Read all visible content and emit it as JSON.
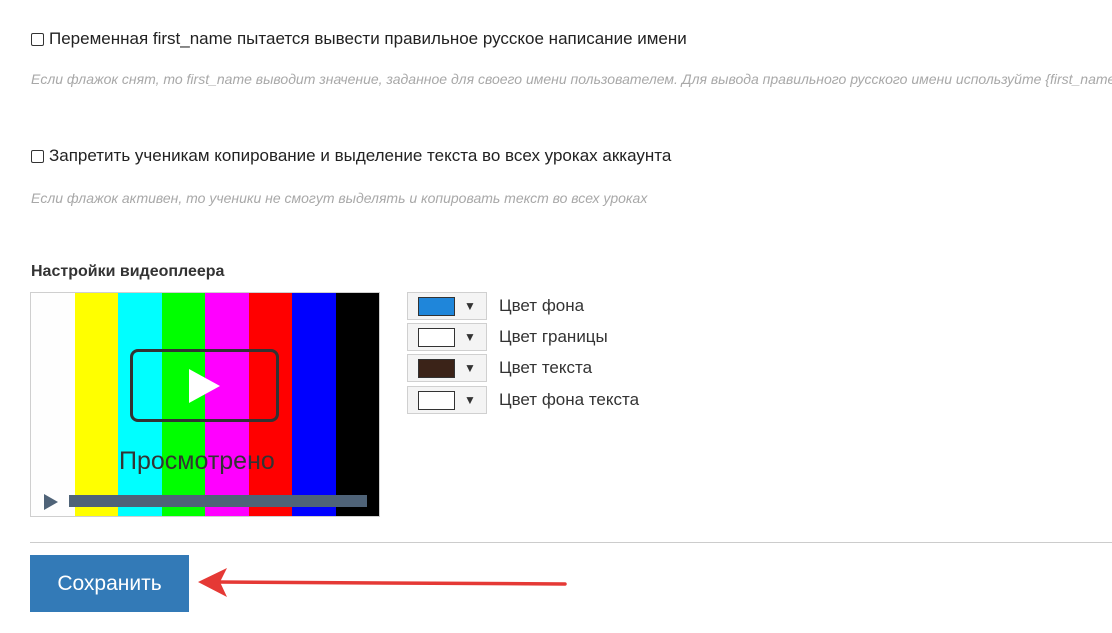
{
  "options": [
    {
      "label": "Переменная first_name пытается вывести правильное русское написание имени",
      "hint": "Если флажок снят, то first_name выводит значение, заданное для своего имени пользователем. Для вывода правильного русского имени используйте {first_name}",
      "checked": false
    },
    {
      "label": "Запретить ученикам копирование и выделение текста во всех уроках аккаунта",
      "hint": "Если флажок активен, то ученики не смогут выделять и копировать текст во всех уроках",
      "checked": false
    }
  ],
  "video_settings": {
    "title": "Настройки видеоплеера",
    "preview": {
      "watched_text": "Просмотрено",
      "bar_colors": [
        "#fefefe",
        "#ffff00",
        "#00ffff",
        "#00ff00",
        "#ff00ff",
        "#ff0000",
        "#0000ff",
        "#000000"
      ],
      "progress_color": "#4f6378"
    },
    "colors": [
      {
        "label": "Цвет фона",
        "value": "#1f86da"
      },
      {
        "label": "Цвет границы",
        "value": "#ffffff"
      },
      {
        "label": "Цвет текста",
        "value": "#3b2318"
      },
      {
        "label": "Цвет фона текста",
        "value": "#ffffff"
      }
    ],
    "caret_icon": "▼"
  },
  "save_button": {
    "label": "Сохранить",
    "color": "#337ab7"
  },
  "annotation_arrow_color": "#e53935"
}
